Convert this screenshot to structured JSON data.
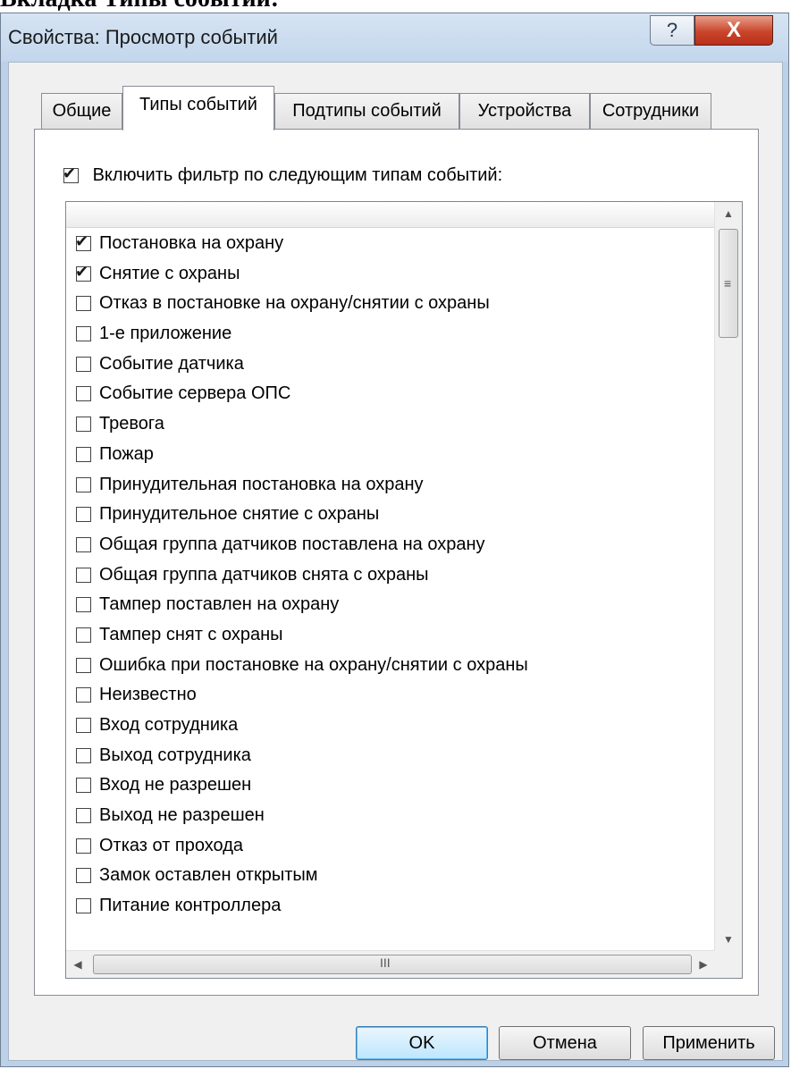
{
  "document_heading": "Вкладка Типы событий:",
  "window": {
    "title": "Свойства: Просмотр событий",
    "help_glyph": "?",
    "close_glyph": "X"
  },
  "tabs": [
    {
      "label": "Общие",
      "active": false
    },
    {
      "label": "Типы событий",
      "active": true
    },
    {
      "label": "Подтипы событий",
      "active": false
    },
    {
      "label": "Устройства",
      "active": false
    },
    {
      "label": "Сотрудники",
      "active": false
    }
  ],
  "filter": {
    "label": "Включить фильтр по следующим типам событий:",
    "checked": true
  },
  "event_types": [
    {
      "label": "Постановка на охрану",
      "checked": true
    },
    {
      "label": "Снятие с охраны",
      "checked": true
    },
    {
      "label": "Отказ в постановке на охрану/снятии с охраны",
      "checked": false
    },
    {
      "label": "1-е приложение",
      "checked": false
    },
    {
      "label": "Событие датчика",
      "checked": false
    },
    {
      "label": "Событие сервера ОПС",
      "checked": false
    },
    {
      "label": "Тревога",
      "checked": false
    },
    {
      "label": "Пожар",
      "checked": false
    },
    {
      "label": "Принудительная постановка на охрану",
      "checked": false
    },
    {
      "label": "Принудительное снятие с охраны",
      "checked": false
    },
    {
      "label": "Общая группа датчиков поставлена на охрану",
      "checked": false
    },
    {
      "label": "Общая группа датчиков снята с охраны",
      "checked": false
    },
    {
      "label": "Тампер поставлен на охрану",
      "checked": false
    },
    {
      "label": "Тампер снят с охраны",
      "checked": false
    },
    {
      "label": "Ошибка при постановке на охрану/снятии с охраны",
      "checked": false
    },
    {
      "label": "Неизвестно",
      "checked": false
    },
    {
      "label": "Вход сотрудника",
      "checked": false
    },
    {
      "label": "Выход сотрудника",
      "checked": false
    },
    {
      "label": "Вход не разрешен",
      "checked": false
    },
    {
      "label": "Выход не разрешен",
      "checked": false
    },
    {
      "label": "Отказ от прохода",
      "checked": false
    },
    {
      "label": "Замок оставлен открытым",
      "checked": false
    },
    {
      "label": "Питание контроллера",
      "checked": false
    }
  ],
  "scrollbar": {
    "up_glyph": "▲",
    "down_glyph": "▼",
    "left_glyph": "◀",
    "right_glyph": "▶",
    "v_grip": "≡",
    "h_grip": "III"
  },
  "buttons": {
    "ok": "OK",
    "cancel": "Отмена",
    "apply": "Применить"
  },
  "check_glyph": "✔"
}
